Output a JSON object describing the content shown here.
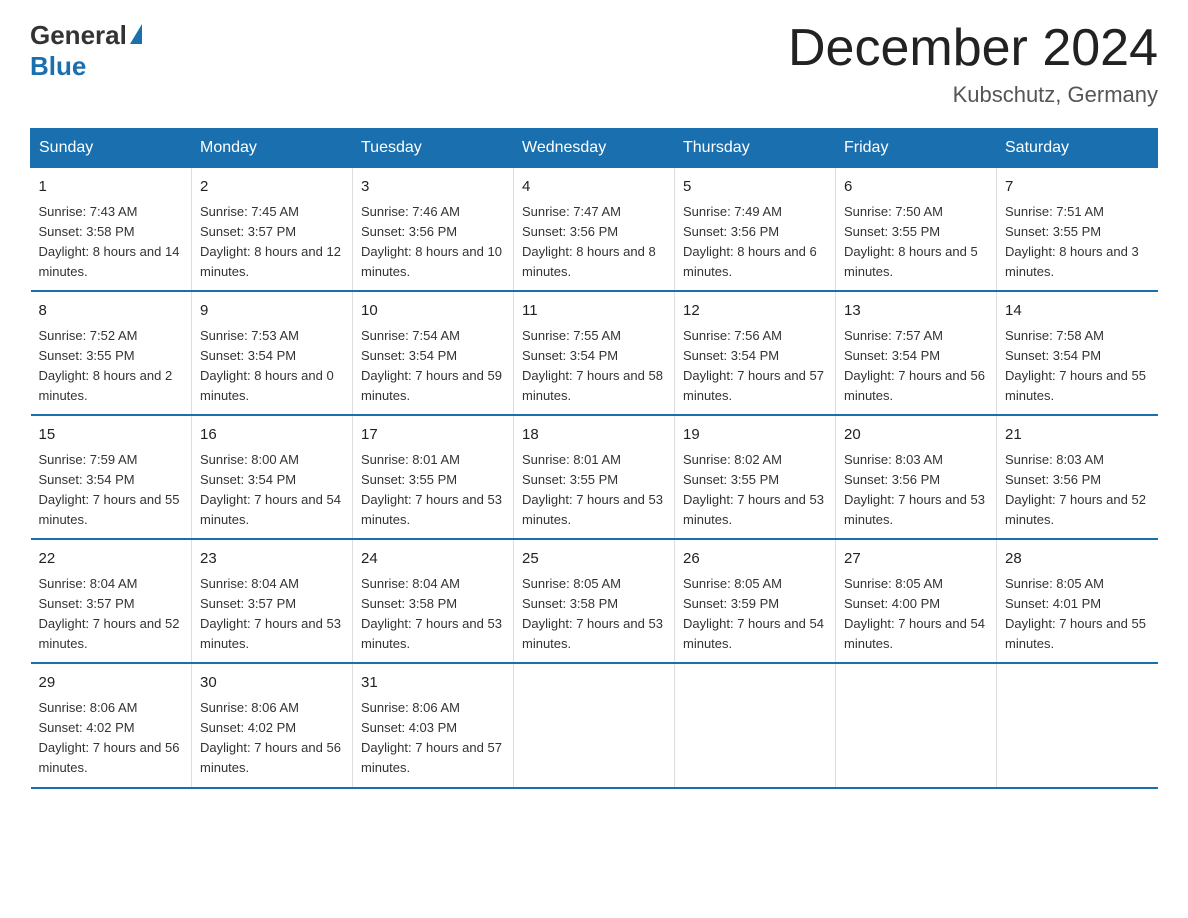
{
  "logo": {
    "general": "General",
    "blue": "Blue"
  },
  "title": {
    "month_year": "December 2024",
    "location": "Kubschutz, Germany"
  },
  "header_days": [
    "Sunday",
    "Monday",
    "Tuesday",
    "Wednesday",
    "Thursday",
    "Friday",
    "Saturday"
  ],
  "weeks": [
    [
      {
        "day": "1",
        "sunrise": "7:43 AM",
        "sunset": "3:58 PM",
        "daylight": "8 hours and 14 minutes."
      },
      {
        "day": "2",
        "sunrise": "7:45 AM",
        "sunset": "3:57 PM",
        "daylight": "8 hours and 12 minutes."
      },
      {
        "day": "3",
        "sunrise": "7:46 AM",
        "sunset": "3:56 PM",
        "daylight": "8 hours and 10 minutes."
      },
      {
        "day": "4",
        "sunrise": "7:47 AM",
        "sunset": "3:56 PM",
        "daylight": "8 hours and 8 minutes."
      },
      {
        "day": "5",
        "sunrise": "7:49 AM",
        "sunset": "3:56 PM",
        "daylight": "8 hours and 6 minutes."
      },
      {
        "day": "6",
        "sunrise": "7:50 AM",
        "sunset": "3:55 PM",
        "daylight": "8 hours and 5 minutes."
      },
      {
        "day": "7",
        "sunrise": "7:51 AM",
        "sunset": "3:55 PM",
        "daylight": "8 hours and 3 minutes."
      }
    ],
    [
      {
        "day": "8",
        "sunrise": "7:52 AM",
        "sunset": "3:55 PM",
        "daylight": "8 hours and 2 minutes."
      },
      {
        "day": "9",
        "sunrise": "7:53 AM",
        "sunset": "3:54 PM",
        "daylight": "8 hours and 0 minutes."
      },
      {
        "day": "10",
        "sunrise": "7:54 AM",
        "sunset": "3:54 PM",
        "daylight": "7 hours and 59 minutes."
      },
      {
        "day": "11",
        "sunrise": "7:55 AM",
        "sunset": "3:54 PM",
        "daylight": "7 hours and 58 minutes."
      },
      {
        "day": "12",
        "sunrise": "7:56 AM",
        "sunset": "3:54 PM",
        "daylight": "7 hours and 57 minutes."
      },
      {
        "day": "13",
        "sunrise": "7:57 AM",
        "sunset": "3:54 PM",
        "daylight": "7 hours and 56 minutes."
      },
      {
        "day": "14",
        "sunrise": "7:58 AM",
        "sunset": "3:54 PM",
        "daylight": "7 hours and 55 minutes."
      }
    ],
    [
      {
        "day": "15",
        "sunrise": "7:59 AM",
        "sunset": "3:54 PM",
        "daylight": "7 hours and 55 minutes."
      },
      {
        "day": "16",
        "sunrise": "8:00 AM",
        "sunset": "3:54 PM",
        "daylight": "7 hours and 54 minutes."
      },
      {
        "day": "17",
        "sunrise": "8:01 AM",
        "sunset": "3:55 PM",
        "daylight": "7 hours and 53 minutes."
      },
      {
        "day": "18",
        "sunrise": "8:01 AM",
        "sunset": "3:55 PM",
        "daylight": "7 hours and 53 minutes."
      },
      {
        "day": "19",
        "sunrise": "8:02 AM",
        "sunset": "3:55 PM",
        "daylight": "7 hours and 53 minutes."
      },
      {
        "day": "20",
        "sunrise": "8:03 AM",
        "sunset": "3:56 PM",
        "daylight": "7 hours and 53 minutes."
      },
      {
        "day": "21",
        "sunrise": "8:03 AM",
        "sunset": "3:56 PM",
        "daylight": "7 hours and 52 minutes."
      }
    ],
    [
      {
        "day": "22",
        "sunrise": "8:04 AM",
        "sunset": "3:57 PM",
        "daylight": "7 hours and 52 minutes."
      },
      {
        "day": "23",
        "sunrise": "8:04 AM",
        "sunset": "3:57 PM",
        "daylight": "7 hours and 53 minutes."
      },
      {
        "day": "24",
        "sunrise": "8:04 AM",
        "sunset": "3:58 PM",
        "daylight": "7 hours and 53 minutes."
      },
      {
        "day": "25",
        "sunrise": "8:05 AM",
        "sunset": "3:58 PM",
        "daylight": "7 hours and 53 minutes."
      },
      {
        "day": "26",
        "sunrise": "8:05 AM",
        "sunset": "3:59 PM",
        "daylight": "7 hours and 54 minutes."
      },
      {
        "day": "27",
        "sunrise": "8:05 AM",
        "sunset": "4:00 PM",
        "daylight": "7 hours and 54 minutes."
      },
      {
        "day": "28",
        "sunrise": "8:05 AM",
        "sunset": "4:01 PM",
        "daylight": "7 hours and 55 minutes."
      }
    ],
    [
      {
        "day": "29",
        "sunrise": "8:06 AM",
        "sunset": "4:02 PM",
        "daylight": "7 hours and 56 minutes."
      },
      {
        "day": "30",
        "sunrise": "8:06 AM",
        "sunset": "4:02 PM",
        "daylight": "7 hours and 56 minutes."
      },
      {
        "day": "31",
        "sunrise": "8:06 AM",
        "sunset": "4:03 PM",
        "daylight": "7 hours and 57 minutes."
      },
      null,
      null,
      null,
      null
    ]
  ],
  "labels": {
    "sunrise": "Sunrise:",
    "sunset": "Sunset:",
    "daylight": "Daylight:"
  }
}
